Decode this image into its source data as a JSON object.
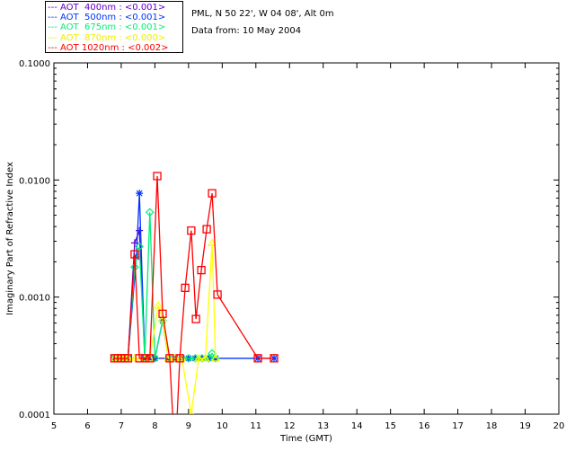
{
  "header": {
    "location": "PML, N 50 22', W 04 08', Alt 0m",
    "date": "Data from: 10 May 2004"
  },
  "legend": [
    {
      "label": "--- AOT  400nm : <0.001>",
      "color": "#6600cc"
    },
    {
      "label": "--- AOT  500nm : <0.001>",
      "color": "#0033ff"
    },
    {
      "label": "--- AOT  675nm : <0.001>",
      "color": "#00ee77"
    },
    {
      "label": "--- AOT  870nm : <0.000>",
      "color": "#ffff00"
    },
    {
      "label": "--- AOT 1020nm : <0.002>",
      "color": "#ff0000"
    }
  ],
  "chart_data": {
    "type": "line",
    "xlabel": "Time (GMT)",
    "ylabel": "Imaginary Part of Refractive Index",
    "xlim": [
      5,
      20
    ],
    "ylim": [
      0.0001,
      0.1
    ],
    "yscale": "log",
    "xticks": [
      "5",
      "6",
      "7",
      "8",
      "9",
      "10",
      "11",
      "12",
      "13",
      "14",
      "15",
      "16",
      "17",
      "18",
      "19",
      "20"
    ],
    "yticks": [
      "0.0001",
      "0.0010",
      "0.0100",
      "0.1000"
    ],
    "series": [
      {
        "name": "AOT 400nm",
        "color": "#6600cc",
        "marker": "plus",
        "x": [
          6.8,
          6.9,
          7.0,
          7.1,
          7.2,
          7.4,
          7.54,
          7.7,
          7.85,
          8.0,
          8.4,
          8.6,
          8.8,
          9.0,
          9.2,
          9.4,
          9.6,
          9.8
        ],
        "y": [
          0.0003,
          0.0003,
          0.0003,
          0.0003,
          0.0003,
          0.0029,
          0.0037,
          0.0003,
          0.0003,
          0.0003,
          0.0003,
          0.0003,
          0.0003,
          0.0003,
          0.0003,
          0.0003,
          0.0003,
          0.0003
        ]
      },
      {
        "name": "AOT 500nm",
        "color": "#0033ff",
        "marker": "star",
        "x": [
          6.8,
          6.9,
          7.0,
          7.1,
          7.2,
          7.45,
          7.54,
          7.7,
          7.85,
          8.0,
          8.23,
          8.4,
          8.6,
          8.8,
          9.0,
          9.2,
          9.4,
          9.6,
          9.8,
          11.06,
          11.54
        ],
        "y": [
          0.0003,
          0.0003,
          0.0003,
          0.0003,
          0.0003,
          0.0022,
          0.0077,
          0.0003,
          0.0003,
          0.0003,
          0.00063,
          0.0003,
          0.0003,
          0.0003,
          0.0003,
          0.0003,
          0.0003,
          0.0003,
          0.0003,
          0.0003,
          0.0003
        ]
      },
      {
        "name": "AOT 675nm",
        "color": "#00ee77",
        "marker": "diamond",
        "x": [
          6.8,
          6.9,
          7.0,
          7.1,
          7.2,
          7.4,
          7.54,
          7.7,
          7.85,
          8.0,
          8.23,
          8.4,
          8.6,
          8.8,
          9.0,
          9.2,
          9.4,
          9.6,
          9.7,
          9.8
        ],
        "y": [
          0.0003,
          0.0003,
          0.0003,
          0.0003,
          0.0003,
          0.0018,
          0.0027,
          0.0003,
          0.0053,
          0.0003,
          0.00063,
          0.0003,
          0.0003,
          0.0003,
          0.0003,
          0.0003,
          0.0003,
          0.0003,
          0.00033,
          0.0003
        ]
      },
      {
        "name": "AOT 870nm",
        "color": "#ffff00",
        "marker": "triangle",
        "x": [
          6.8,
          6.9,
          7.0,
          7.1,
          7.2,
          7.4,
          7.7,
          7.85,
          8.1,
          8.23,
          8.4,
          8.6,
          8.8,
          9.08,
          9.3,
          9.5,
          9.7,
          9.8
        ],
        "y": [
          0.0003,
          0.0003,
          0.0003,
          0.0003,
          0.0003,
          0.0003,
          0.0003,
          0.0003,
          0.00085,
          0.00065,
          0.0003,
          0.0003,
          0.0003,
          0.0001,
          0.0003,
          0.0003,
          0.0029,
          0.0003
        ]
      },
      {
        "name": "AOT 1020nm",
        "color": "#ff0000",
        "marker": "square",
        "x": [
          6.8,
          6.9,
          7.0,
          7.1,
          7.2,
          7.4,
          7.54,
          7.7,
          7.85,
          8.07,
          8.23,
          8.44,
          8.6,
          8.74,
          8.9,
          9.08,
          9.22,
          9.38,
          9.54,
          9.7,
          9.86,
          11.06,
          11.54
        ],
        "y": [
          0.0003,
          0.0003,
          0.0003,
          0.0003,
          0.0003,
          0.00232,
          0.0003,
          0.0003,
          0.0003,
          0.0108,
          0.00072,
          0.0003,
          4e-05,
          0.0003,
          0.0012,
          0.0037,
          0.00065,
          0.0017,
          0.0038,
          0.0077,
          0.00105,
          0.0003,
          0.0003
        ]
      }
    ]
  }
}
